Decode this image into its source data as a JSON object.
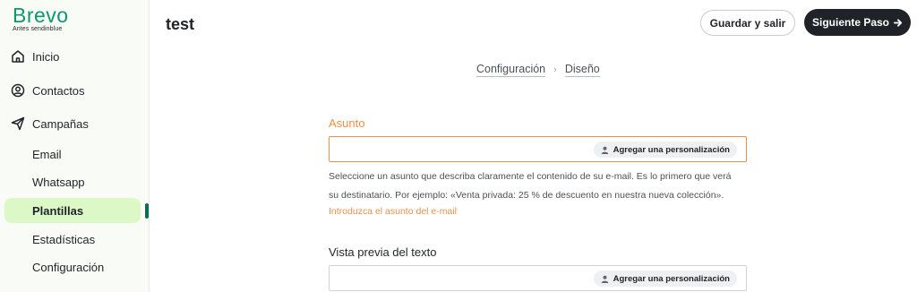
{
  "brand": {
    "name": "Brevo",
    "tagline": "Antes sendinblue",
    "color": "#0b996e"
  },
  "sidebar": {
    "items": [
      {
        "label": "Inicio",
        "icon": "home-icon"
      },
      {
        "label": "Contactos",
        "icon": "contacts-icon"
      },
      {
        "label": "Campañas",
        "icon": "send-icon"
      }
    ],
    "subitems": [
      {
        "label": "Email"
      },
      {
        "label": "Whatsapp"
      },
      {
        "label": "Plantillas",
        "active": true
      },
      {
        "label": "Estadísticas"
      },
      {
        "label": "Configuración"
      }
    ]
  },
  "header": {
    "title": "test",
    "save_label": "Guardar y salir",
    "next_label": "Siguiente Paso"
  },
  "breadcrumb": {
    "step1": "Configuración",
    "step2": "Diseño"
  },
  "form": {
    "subject": {
      "label": "Asunto",
      "value": "",
      "personalize_label": "Agregar una personalización",
      "helper_line1": "Seleccione un asunto que describa claramente el contenido de su e-mail. Es lo primero que verá",
      "helper_line2": "su destinatario. Por ejemplo: «Venta privada: 25 % de descuento en nuestra nueva colección».",
      "error": "Introduzca el asunto del e-mail"
    },
    "preview": {
      "label": "Vista previa del texto",
      "value": "",
      "personalize_label": "Agregar una personalización"
    }
  },
  "colors": {
    "accent_warning": "#e8904a",
    "active_pill": "#dcf8c6",
    "primary_button": "#1f2328"
  }
}
